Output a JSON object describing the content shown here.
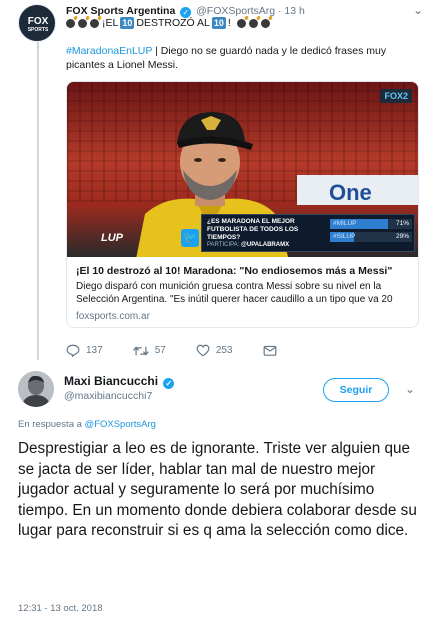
{
  "parent": {
    "author_name": "FOX Sports Argentina",
    "author_handle": "@FOXSportsArg",
    "time_ago": "· 13 h",
    "title": {
      "part1": "¡EL",
      "num1": "10",
      "part2": "DESTROZÓ AL",
      "num2": "10",
      "part3": "!"
    },
    "hashtag": "#MaradonaEnLUP",
    "text": " | Diego no se guardó nada y le dedicó frases muy picantes a Lionel Messi.",
    "card": {
      "tv_bug": "FOX",
      "tv_bug_num": "2",
      "lup_logo": "LUP",
      "poll_question": "¿ES MARADONA EL MEJOR FUTBOLISTA DE TODOS LOS TIEMPOS?",
      "poll_options": [
        {
          "label": "#MILUP",
          "percent": 71,
          "display": "71%"
        },
        {
          "label": "#SILUP",
          "percent": 29,
          "display": "29%"
        }
      ],
      "poll_footer_label": "PARTICIPA:",
      "poll_footer_handle": "@UPALABRAMX",
      "title": "¡El 10 destrozó al 10! Maradona: \"No endiosemos más a Messi\"",
      "description": "Diego disparó con munición gruesa contra Messi sobre su nivel en la Selección Argentina. \"Es inútil querer hacer caudillo a un tipo que va 20",
      "domain": "foxsports.com.ar"
    },
    "actions": {
      "replies": "137",
      "retweets": "57",
      "likes": "253"
    }
  },
  "reply": {
    "author_name": "Maxi Biancucchi",
    "author_handle": "@maxibiancucchi7",
    "follow_label": "Seguir",
    "in_reply_prefix": "En respuesta a ",
    "in_reply_handle": "@FOXSportsArg",
    "text": "Desprestigiar a leo es de ignorante. Triste ver alguien que se jacta de ser líder, hablar tan mal de nuestro mejor jugador actual y seguramente lo será por muchísimo tiempo. En un momento donde debiera colaborar desde su lugar para reconstruir si es q ama la selección como dice.",
    "timestamp": "12:31 - 13 oct. 2018"
  },
  "colors": {
    "link": "#1b95e0",
    "verified": "#1da1f2",
    "muted": "#657786",
    "divider": "#e1e8ed"
  }
}
